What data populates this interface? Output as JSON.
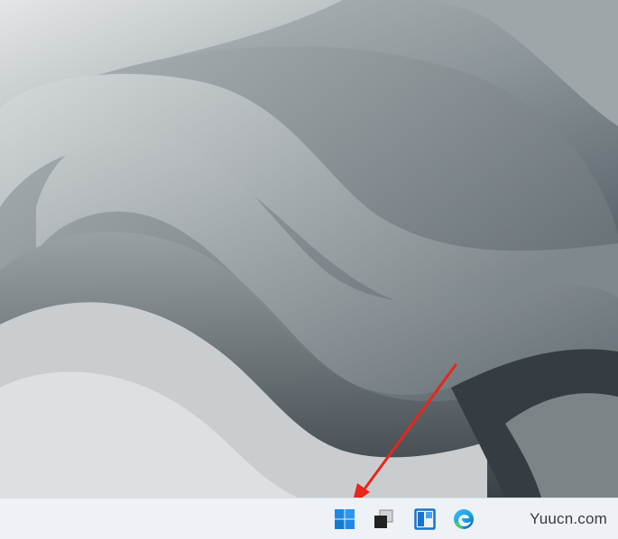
{
  "desktop": {
    "wallpaper": "windows-11-bloom-grey",
    "colors": {
      "light": "#c4c9cb",
      "mid": "#8b9498",
      "dark": "#3f484e"
    }
  },
  "taskbar": {
    "background": "#eef2f6",
    "items": [
      {
        "icon": "windows-start-icon",
        "color": "#1e88e5"
      },
      {
        "icon": "task-view-icon",
        "color": "#222222"
      },
      {
        "icon": "widgets-icon",
        "color": "#1a73c9"
      },
      {
        "icon": "edge-browser-icon",
        "color": "#1b9de2"
      }
    ]
  },
  "annotation": {
    "arrow_color": "#e8261c"
  },
  "watermark": {
    "text": "Yuucn.com"
  }
}
